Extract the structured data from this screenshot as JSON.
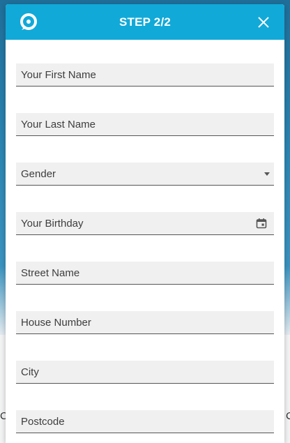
{
  "header": {
    "title": "STEP 2/2",
    "logo_icon": "chat-q-logo-icon",
    "close_icon": "close-icon",
    "accent_color": "#11a9d8"
  },
  "form": {
    "fields": [
      {
        "label": "Your First Name",
        "type": "text"
      },
      {
        "label": "Your Last Name",
        "type": "text"
      },
      {
        "label": "Gender",
        "type": "select"
      },
      {
        "label": "Your Birthday",
        "type": "date"
      },
      {
        "label": "Street Name",
        "type": "text"
      },
      {
        "label": "House Number",
        "type": "text"
      },
      {
        "label": "City",
        "type": "text"
      },
      {
        "label": "Postcode",
        "type": "text"
      }
    ]
  },
  "background": {
    "left_edge_text": "C",
    "right_edge_text": "C"
  }
}
